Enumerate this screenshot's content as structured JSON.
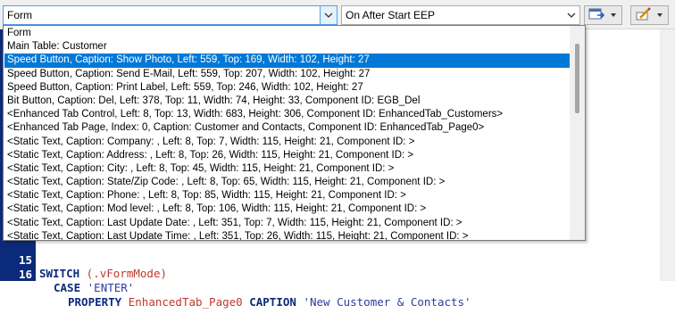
{
  "toolbar": {
    "object_combo_value": "Form",
    "event_combo_value": "On After Start EEP"
  },
  "dropdown": {
    "items": [
      "Form",
      "Main Table: Customer",
      "Speed Button, Caption: Show Photo, Left: 559, Top: 169, Width: 102, Height: 27",
      "Speed Button, Caption: Send E-Mail, Left: 559, Top: 207, Width: 102, Height: 27",
      "Speed Button, Caption: Print Label, Left: 559, Top: 246, Width: 102, Height: 27",
      "Bit Button, Caption: Del, Left: 378, Top: 11, Width: 74, Height: 33, Component ID: EGB_Del",
      "<Enhanced Tab Control, Left: 8, Top: 13, Width: 683, Height: 306, Component ID: EnhancedTab_Customers>",
      "<Enhanced Tab Page, Index: 0, Caption: Customer and Contacts, Component ID: EnhancedTab_Page0>",
      "<Static Text, Caption: Company: , Left: 8, Top: 7, Width: 115, Height: 21, Component ID: >",
      "<Static Text, Caption: Address: , Left: 8, Top: 26, Width: 115, Height: 21, Component ID: >",
      "<Static Text, Caption: City: , Left: 8, Top: 45, Width: 115, Height: 21, Component ID: >",
      "<Static Text, Caption: State/Zip Code: , Left: 8, Top: 65, Width: 115, Height: 21, Component ID: >",
      "<Static Text, Caption: Phone: , Left: 8, Top: 85, Width: 115, Height: 21, Component ID: >",
      "<Static Text, Caption: Mod level: , Left: 8, Top: 106, Width: 115, Height: 21, Component ID: >",
      "<Static Text, Caption: Last Update Date: , Left: 351, Top: 7, Width: 115, Height: 21, Component ID: >",
      "<Static Text, Caption: Last Update Time: , Left: 351, Top: 26, Width: 115, Height: 21, Component ID: >"
    ],
    "selected_index": 2
  },
  "editor": {
    "lines": [
      {
        "num": "15",
        "kw1": "SWITCH",
        "rest": " (.vFormMode)"
      },
      {
        "num": "16",
        "kw1": "CASE",
        "str": "'ENTER'"
      },
      {
        "num": "17",
        "kw1": "PROPERTY",
        "var": "EnhancedTab_Page0",
        "kw2": "CAPTION",
        "str": "'New Customer & Contacts'"
      }
    ]
  },
  "colors": {
    "selection": "#0078d7",
    "gutter": "#0b2a7a",
    "keyword": "#0b2a7a",
    "variable": "#c0392b"
  }
}
